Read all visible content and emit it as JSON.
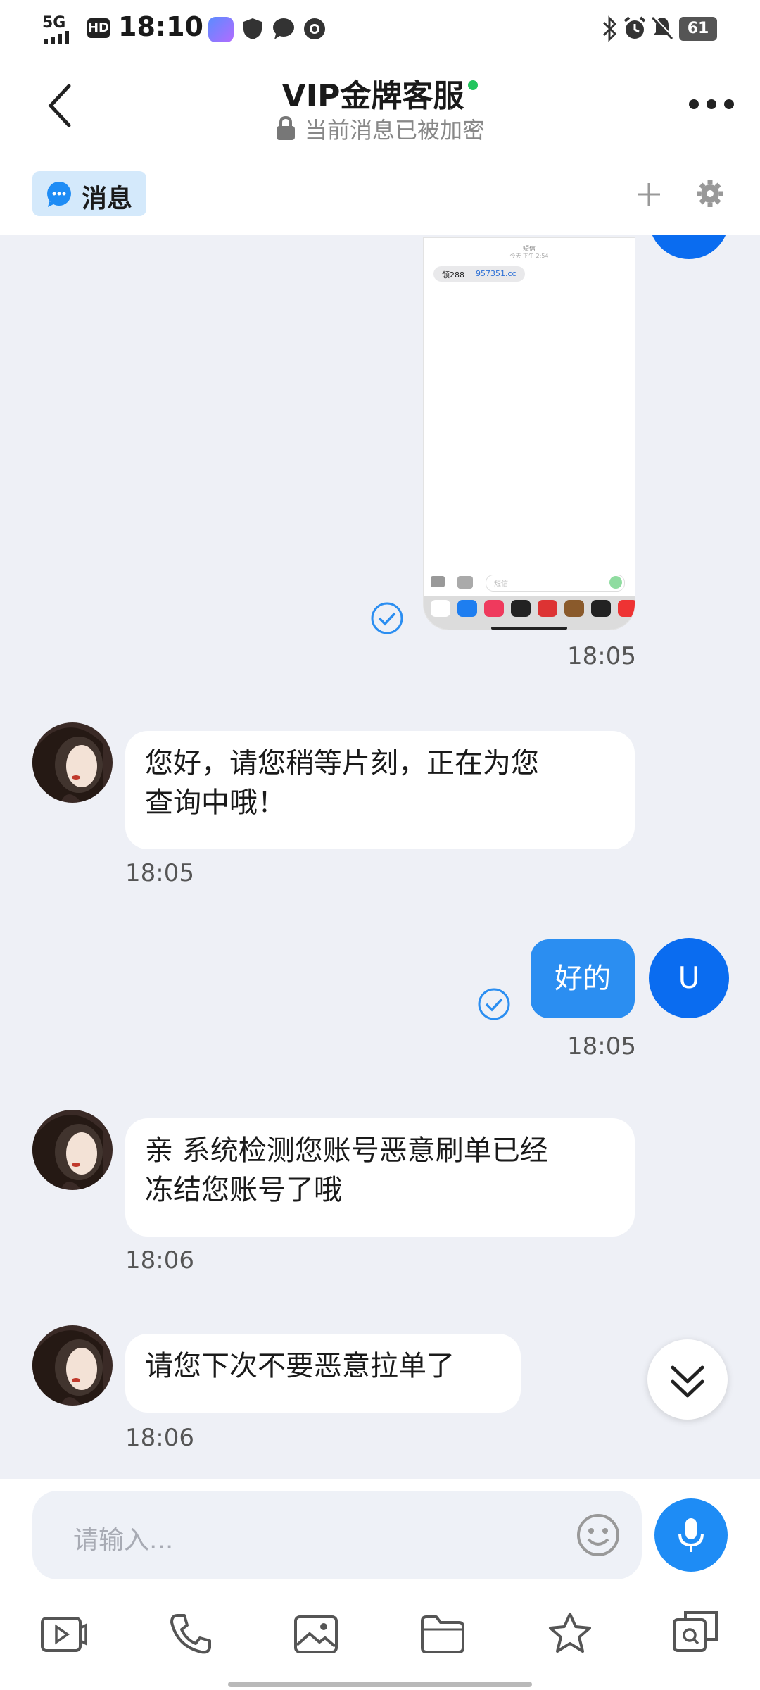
{
  "status_bar": {
    "network": "5G",
    "hd": "HD",
    "time": "18:10",
    "battery": "61"
  },
  "header": {
    "title": "VIP金牌客服",
    "subtitle": "当前消息已被加密",
    "online_color": "#22c55e"
  },
  "tabs": {
    "active_label": "消息"
  },
  "screenshot_thumb": {
    "header_line1": "短信",
    "header_line2": "今天 下午 2:54",
    "message_prefix": "领288",
    "message_link": "957351.cc",
    "input_placeholder": "短信"
  },
  "messages": [
    {
      "side": "out",
      "time": "18:05"
    },
    {
      "side": "in",
      "text_line1": "您好，请您稍等片刻，正在为您",
      "text_line2": "查询中哦！",
      "time": "18:05"
    },
    {
      "side": "out",
      "text": "好的",
      "avatar_letter": "U",
      "time": "18:05"
    },
    {
      "side": "in",
      "text_line1": "亲 系统检测您账号恶意刷单已经",
      "text_line2": "冻结您账号了哦",
      "time": "18:06"
    },
    {
      "side": "in",
      "text_line1": "请您下次不要恶意拉单了",
      "time": "18:06"
    }
  ],
  "composer": {
    "placeholder": "请输入..."
  },
  "colors": {
    "accent": "#1e8cf5",
    "chat_background": "#eef0f6",
    "outgoing_bubble": "#2b8ef1",
    "tab_chip": "#d4e9fb"
  },
  "toolbar_icons": [
    "video-icon",
    "phone-icon",
    "image-icon",
    "folder-icon",
    "star-icon",
    "screenshot-search-icon"
  ]
}
